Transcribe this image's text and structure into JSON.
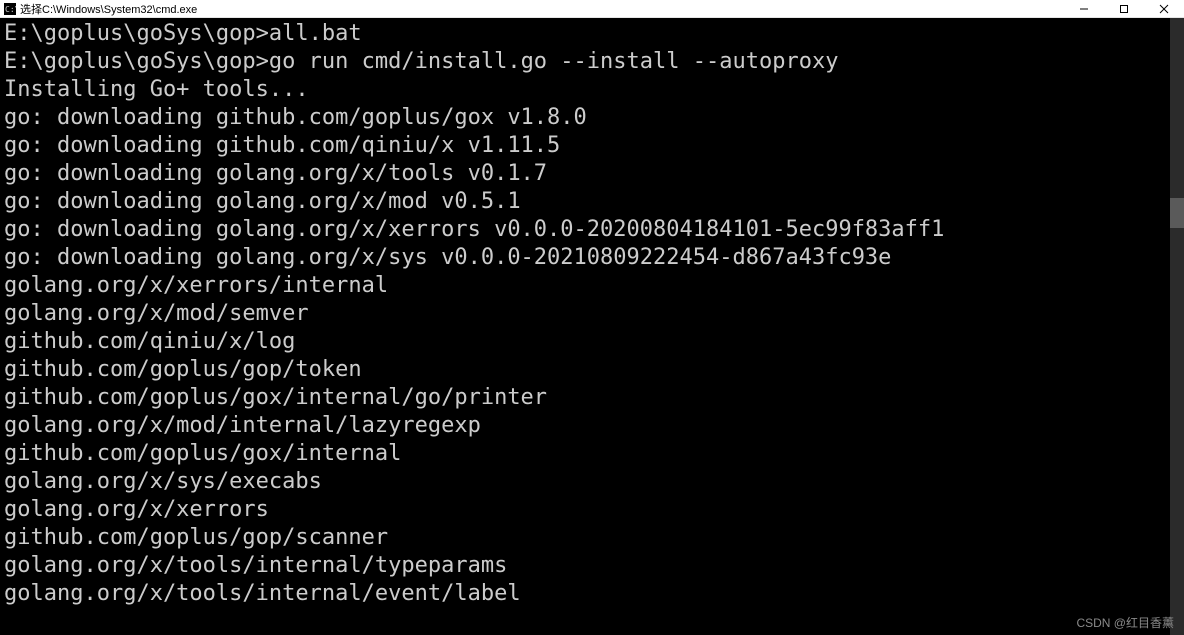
{
  "window": {
    "title": "选择C:\\Windows\\System32\\cmd.exe",
    "icon_label": "cmd"
  },
  "terminal": {
    "prompt1": "E:\\goplus\\goSys\\gop>",
    "command1": "all.bat",
    "blank1": "",
    "prompt2": "E:\\goplus\\goSys\\gop>",
    "command2": "go run cmd/install.go --install --autoproxy",
    "lines": [
      "Installing Go+ tools...",
      "go: downloading github.com/goplus/gox v1.8.0",
      "go: downloading github.com/qiniu/x v1.11.5",
      "go: downloading golang.org/x/tools v0.1.7",
      "go: downloading golang.org/x/mod v0.5.1",
      "go: downloading golang.org/x/xerrors v0.0.0-20200804184101-5ec99f83aff1",
      "go: downloading golang.org/x/sys v0.0.0-20210809222454-d867a43fc93e",
      "golang.org/x/xerrors/internal",
      "golang.org/x/mod/semver",
      "github.com/qiniu/x/log",
      "github.com/goplus/gop/token",
      "github.com/goplus/gox/internal/go/printer",
      "golang.org/x/mod/internal/lazyregexp",
      "github.com/goplus/gox/internal",
      "golang.org/x/sys/execabs",
      "golang.org/x/xerrors",
      "github.com/goplus/gop/scanner",
      "golang.org/x/tools/internal/typeparams",
      "golang.org/x/tools/internal/event/label"
    ]
  },
  "watermark": "CSDN @红目香薰"
}
